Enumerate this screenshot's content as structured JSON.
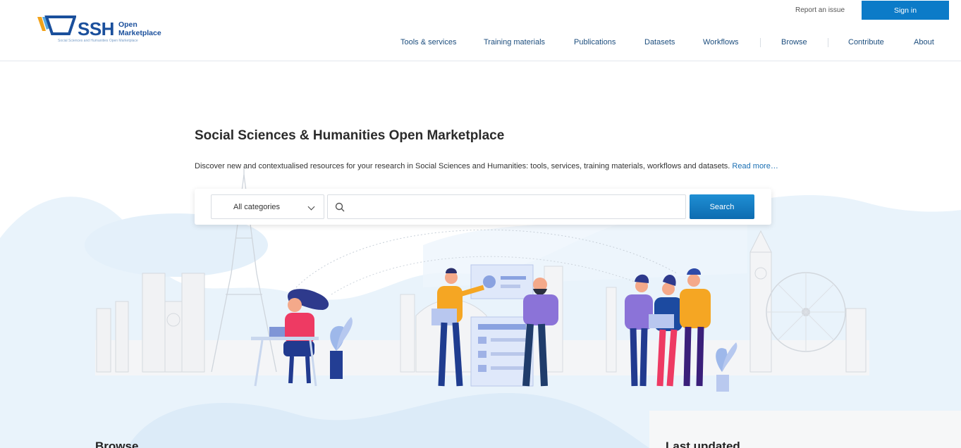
{
  "header": {
    "logo": {
      "abbr": "SSH",
      "word1": "Open",
      "word2": "Marketplace",
      "tagline": "Social Sciences and Humanities Open Marketplace"
    },
    "report_issue": "Report an issue",
    "sign_in": "Sign in"
  },
  "nav": {
    "items": [
      {
        "label": "Tools & services"
      },
      {
        "label": "Training materials"
      },
      {
        "label": "Publications"
      },
      {
        "label": "Datasets"
      },
      {
        "label": "Workflows"
      },
      {
        "label": "Browse"
      },
      {
        "label": "Contribute"
      },
      {
        "label": "About"
      }
    ]
  },
  "hero": {
    "title": "Social Sciences & Humanities Open Marketplace",
    "description": "Discover new and contextualised resources for your research in Social Sciences and Humanities: tools, services, training materials, workflows and datasets.",
    "read_more": "Read more…"
  },
  "search": {
    "category": "All categories",
    "placeholder": "",
    "button": "Search"
  },
  "sections": {
    "browse": "Browse",
    "last_updated": "Last updated"
  },
  "colors": {
    "brand": "#1a4f9c",
    "accent": "#0c7bc8",
    "nav_text": "#1d4e7e"
  }
}
